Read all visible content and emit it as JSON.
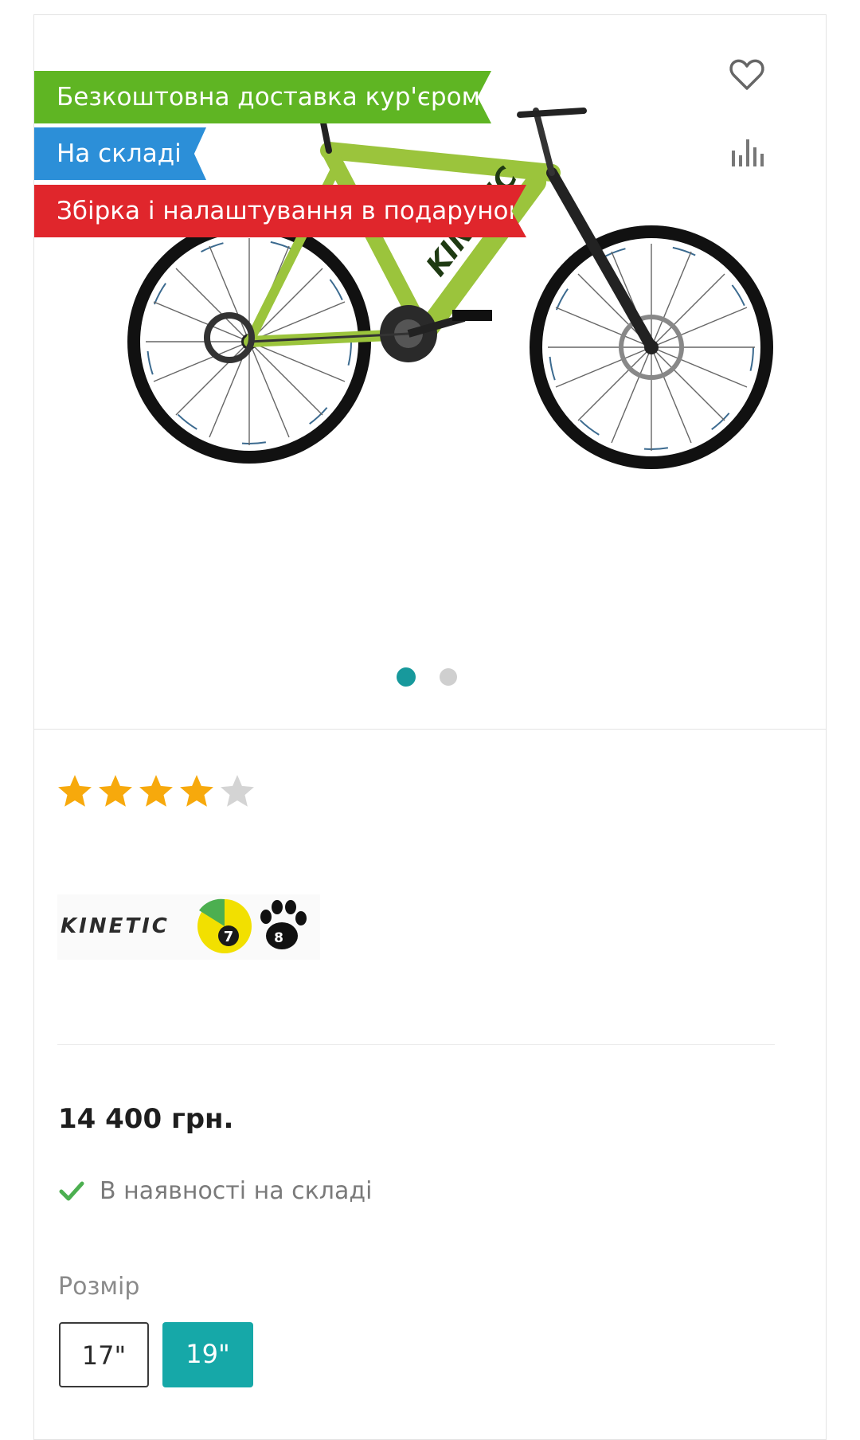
{
  "product": {
    "badges": [
      {
        "label": "Безкоштовна доставка кур'єром",
        "color": "#5fb523"
      },
      {
        "label": "На складі",
        "color": "#2c8fd8"
      },
      {
        "label": "Збірка і налаштування в подарунок",
        "color": "#e0262c"
      }
    ],
    "image": {
      "icon": "bicycle-image",
      "brand_on_frame": "KINETIC",
      "frame_color": "#9bc43c"
    },
    "gallery": {
      "slides": 2,
      "active_slide": 1,
      "active_color": "#17999c"
    },
    "actions": {
      "wishlist_icon": "heart-icon",
      "compare_icon": "bar-chart-icon"
    },
    "rating": {
      "value": 4,
      "max": 5
    },
    "brand": {
      "logo_text": "KINETIC",
      "logo_badge_7": "7",
      "logo_badge_8": "8"
    },
    "price": "14 400 грн.",
    "availability": {
      "text": "В наявності на складі",
      "icon": "check-icon",
      "color": "#4caf50"
    },
    "size": {
      "label": "Розмір",
      "options": [
        "17\"",
        "19\""
      ],
      "selected": "19\"",
      "selected_color": "#16a8a8"
    }
  }
}
